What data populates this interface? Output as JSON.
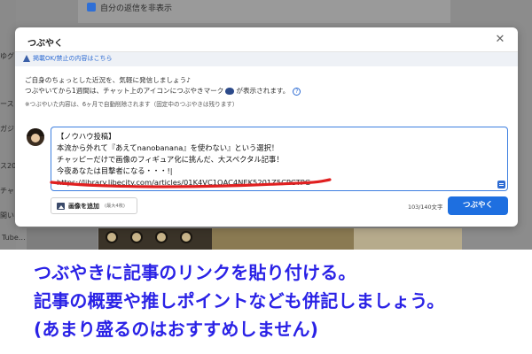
{
  "background": {
    "top_checkbox_label": "自分の返信を非表示",
    "side_fragments": [
      "ゆグ",
      "ース",
      "ガジ",
      "ス20",
      "チャ",
      "開い"
    ],
    "bottom_text": "Tube…"
  },
  "dialog": {
    "title": "つぶやく",
    "close_icon": "close-icon",
    "notice_link": "掲載OK/禁止の内容はこちら",
    "description": {
      "line1": "ご自身のちょっとした近況を、気軽に発信しましょう♪",
      "line2_before": "つぶやいてから1週間は、チャット上のアイコンにつぶやきマーク",
      "line2_after": "が表示されます。",
      "line3": "※つぶやいた内容は、6ヶ月で自動削除されます（固定中のつぶやきは残ります）"
    },
    "textarea": {
      "lines": [
        "【ノウハウ投稿】",
        "本流から外れて『あえてnanobanana』を使わない』という選択！",
        "チャッピーだけで画像のフィギュア化に挑んだ、大スペクタル記事！",
        "今夜あなたは目撃者になる・・・!|",
        "https://library.libecity.com/articles/01K4VC1QAC4NEK5201Z5CPCTPG"
      ]
    },
    "add_image": {
      "label": "画像を追加",
      "sub": "(最大4枚)"
    },
    "char_count": "103/140文字",
    "submit_label": "つぶやく"
  },
  "caption": {
    "line1": "つぶやきに記事のリンクを貼り付ける。",
    "line2": "記事の概要や推しポイントなども併記しましょう。",
    "line3": "(あまり盛るのはおすすめしません)"
  },
  "colors": {
    "accent": "#1e6fe0",
    "caption": "#2a22e6",
    "annotation": "#e02020"
  }
}
